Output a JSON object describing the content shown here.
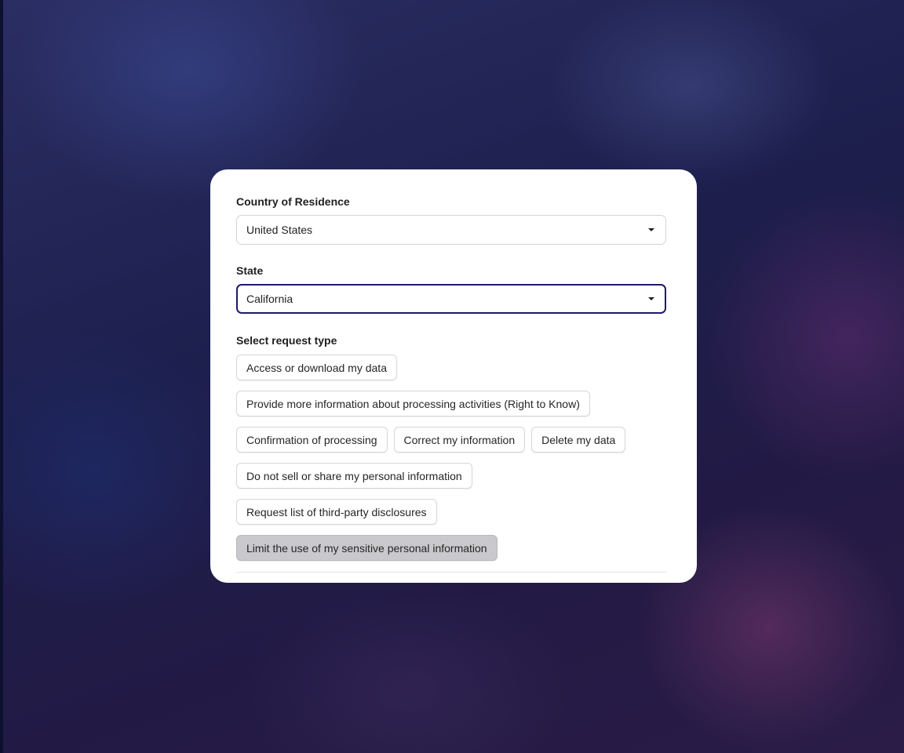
{
  "form": {
    "country": {
      "label": "Country of Residence",
      "value": "United States"
    },
    "state": {
      "label": "State",
      "value": "California"
    },
    "request_type": {
      "label": "Select request type",
      "rows": [
        [
          "Access or download my data"
        ],
        [
          "Provide more information about processing activities (Right to Know)"
        ],
        [
          "Confirmation of processing",
          "Correct my information",
          "Delete my data"
        ],
        [
          "Do not sell or share my personal information"
        ],
        [
          "Request list of third-party disclosures"
        ],
        [
          "Limit the use of my sensitive personal information"
        ]
      ],
      "selected": "Limit the use of my sensitive personal information"
    }
  },
  "colors": {
    "focus_border": "#1d1a6b",
    "selected_chip": "#c9c8cc",
    "card_background": "#ffffff"
  },
  "icons": {
    "dropdown": "caret-down-icon"
  }
}
